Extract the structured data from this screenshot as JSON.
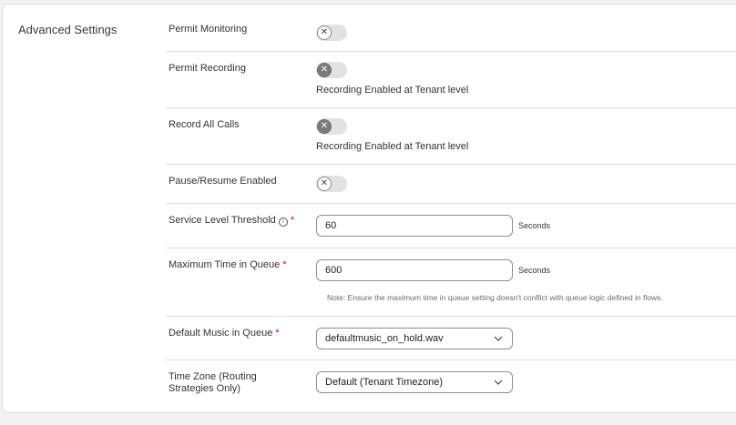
{
  "section": {
    "title": "Advanced Settings"
  },
  "rows": {
    "permit_monitoring": {
      "label": "Permit Monitoring",
      "enabled": false
    },
    "permit_recording": {
      "label": "Permit Recording",
      "enabled": false,
      "note": "Recording Enabled at Tenant level"
    },
    "record_all_calls": {
      "label": "Record All Calls",
      "enabled": false,
      "note": "Recording Enabled at Tenant level"
    },
    "pause_resume": {
      "label": "Pause/Resume Enabled",
      "enabled": false
    },
    "service_level": {
      "label": "Service Level Threshold",
      "required_mark": "*",
      "value": "60",
      "unit": "Seconds"
    },
    "max_time_queue": {
      "label": "Maximum Time in Queue",
      "required_mark": "*",
      "value": "600",
      "unit": "Seconds",
      "note": "Note: Ensure the maximum time in queue setting doesn't conflict with queue logic defined in flows."
    },
    "default_music": {
      "label": "Default Music in Queue",
      "required_mark": "*",
      "value": "defaultmusic_on_hold.wav"
    },
    "time_zone": {
      "label_line1": "Time Zone (Routing",
      "label_line2": "Strategies Only)",
      "value": "Default (Tenant Timezone)"
    }
  },
  "icons": {
    "toggle_off": "x-icon",
    "info": "info-icon",
    "dropdown": "chevron-down-icon"
  }
}
